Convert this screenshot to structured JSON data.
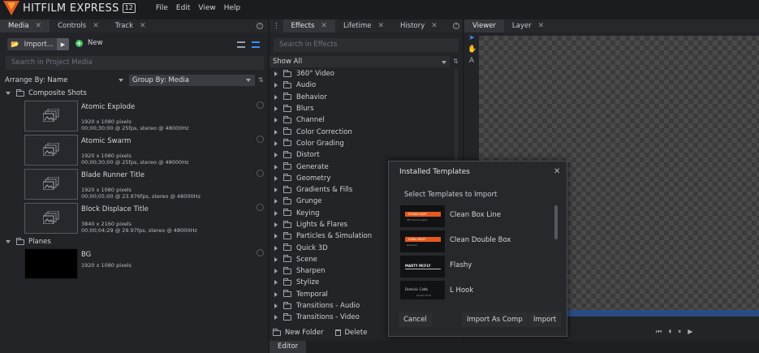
{
  "app": {
    "logo_text": "HITFILM EXPRESS",
    "version_badge": "12",
    "colors": {
      "accent": "#3c8ff0",
      "logo": "#e45a1e",
      "new": "#3fbf5a"
    }
  },
  "menu": [
    "File",
    "Edit",
    "View",
    "Help"
  ],
  "media_panel": {
    "tabs": [
      "Media",
      "Controls",
      "Track"
    ],
    "import_label": "Import...",
    "new_label": "New",
    "search_placeholder": "Search in Project Media",
    "arrange_by": "Arrange By: Name",
    "group_by": "Group By: Media",
    "folders": [
      {
        "name": "Composite Shots",
        "items": [
          {
            "name": "Atomic Explode",
            "resolution": "1920 x 1080 pixels",
            "details": "00;00;30;00 @ 25fps, stereo @ 48000Hz"
          },
          {
            "name": "Atomic Swarm",
            "resolution": "1920 x 1080 pixels",
            "details": "00;00;30;00 @ 25fps, stereo @ 48000Hz"
          },
          {
            "name": "Blade Runner Title",
            "resolution": "1920 x 1080 pixels",
            "details": "00;00;05;00 @ 23.976fps, stereo @ 48000Hz"
          },
          {
            "name": "Block Displace Title",
            "resolution": "3840 x 2160 pixels",
            "details": "00;00;04;29 @ 29.97fps, stereo @ 48000Hz"
          }
        ]
      },
      {
        "name": "Planes",
        "items": [
          {
            "name": "BG",
            "resolution": "1920 x 1080 pixels",
            "details": ""
          }
        ]
      }
    ]
  },
  "effects_panel": {
    "tabs": [
      "Effects",
      "Lifetime",
      "History"
    ],
    "search_placeholder": "Search in Effects",
    "filter": "Show All",
    "categories": [
      "360° Video",
      "Audio",
      "Behavior",
      "Blurs",
      "Channel",
      "Color Correction",
      "Color Grading",
      "Distort",
      "Generate",
      "Geometry",
      "Gradients & Fills",
      "Grunge",
      "Keying",
      "Lights & Flares",
      "Particles & Simulation",
      "Quick 3D",
      "Scene",
      "Sharpen",
      "Stylize",
      "Temporal",
      "Transitions - Audio",
      "Transitions - Video"
    ],
    "new_folder_label": "New Folder",
    "delete_label": "Delete"
  },
  "viewer_panel": {
    "tabs": [
      "Viewer",
      "Layer"
    ]
  },
  "editor": {
    "tab": "Editor"
  },
  "dialog": {
    "title": "Installed Templates",
    "subtitle": "Select Templates to Import",
    "templates": [
      {
        "name": "Clean Box Line",
        "thumb_text": "ETHAN HUNT",
        "thumb_sub": "IMF Secret Agent",
        "style": "bar"
      },
      {
        "name": "Clean Double Box",
        "thumb_text": "SARA CRAFT",
        "thumb_sub": "Reporter",
        "style": "bar"
      },
      {
        "name": "Flashy",
        "thumb_text": "MARTY MCFLY",
        "thumb_sub": "",
        "style": "flash"
      },
      {
        "name": "L Hook",
        "thumb_text": "Dominic Cobb",
        "thumb_sub": "Dream thief",
        "style": "plain"
      }
    ],
    "buttons": {
      "cancel": "Cancel",
      "import_as_comp": "Import As Comp",
      "import": "Import"
    }
  }
}
